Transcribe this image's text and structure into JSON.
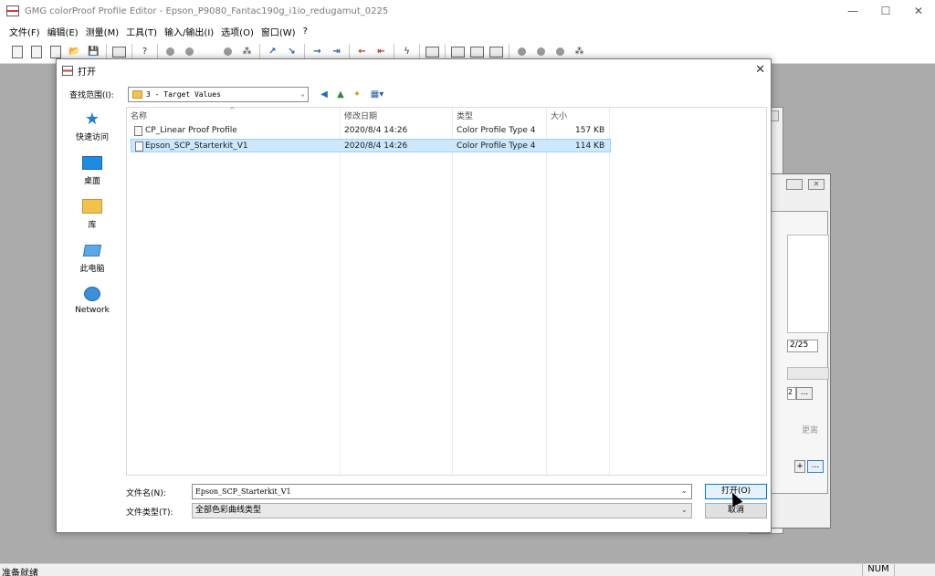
{
  "window": {
    "title": "GMG colorProof Profile Editor - Epson_P9080_Fantac190g_i1io_redugamut_0225",
    "minimize": "—",
    "maximize": "☐",
    "close": "✕"
  },
  "menu": [
    "文件(F)",
    "编辑(E)",
    "测量(M)",
    "工具(T)",
    "输入/输出(I)",
    "选项(O)",
    "窗口(W)",
    "?"
  ],
  "status": {
    "text": "准备就绪",
    "num": "NUM"
  },
  "bg_dialog": {
    "value_field": "2/25",
    "small_field": "2",
    "ellipsis": "...",
    "more_label": "更离",
    "plus": "+",
    "ellipsis2": "..."
  },
  "dialog": {
    "title": "打开",
    "close": "✕",
    "look_in_label": "查找范围(I):",
    "look_in_value": "3 - Target Values",
    "places": [
      {
        "label": "快速访问",
        "icon": "star-icon"
      },
      {
        "label": "桌面",
        "icon": "desktop-icon"
      },
      {
        "label": "库",
        "icon": "library-icon"
      },
      {
        "label": "此电脑",
        "icon": "computer-icon"
      },
      {
        "label": "Network",
        "icon": "network-icon"
      }
    ],
    "columns": {
      "name": "名称",
      "modified": "修改日期",
      "type": "类型",
      "size": "大小"
    },
    "files": [
      {
        "name": "CP_Linear Proof Profile",
        "modified": "2020/8/4 14:26",
        "type": "Color Profile Type 4",
        "size": "157 KB",
        "selected": false
      },
      {
        "name": "Epson_SCP_Starterkit_V1",
        "modified": "2020/8/4 14:26",
        "type": "Color Profile Type 4",
        "size": "114 KB",
        "selected": true
      }
    ],
    "file_name_label": "文件名(N):",
    "file_name_value": "Epson_SCP_Starterkit_V1",
    "file_type_label": "文件类型(T):",
    "file_type_value": "全部色彩曲线类型",
    "open_button": "打开(O)",
    "cancel_button": "取消"
  }
}
